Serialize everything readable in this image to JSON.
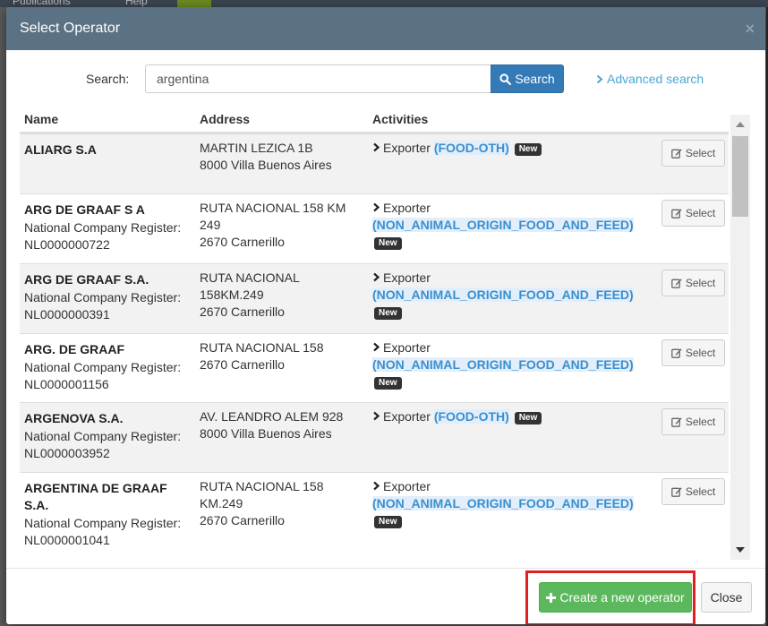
{
  "background": {
    "menu_publications": "Publications",
    "menu_help": "Help"
  },
  "modal": {
    "title": "Select Operator",
    "close_glyph": "×"
  },
  "search": {
    "label": "Search:",
    "value": "argentina",
    "button_label": "Search",
    "advanced_label": "Advanced search"
  },
  "table": {
    "headers": {
      "name": "Name",
      "address": "Address",
      "activities": "Activities"
    },
    "select_label": "Select",
    "rows": [
      {
        "name": "ALIARG S.A",
        "reg_label": "",
        "reg_no": "",
        "addr1": "MARTIN LEZICA 1B",
        "addr2": "8000 Villa Buenos Aires",
        "activity": "Exporter",
        "code": "(FOOD-OTH)",
        "badge": "New"
      },
      {
        "name": "ARG DE GRAAF S A",
        "reg_label": "National Company Register:",
        "reg_no": "NL0000000722",
        "addr1": "RUTA NACIONAL 158 KM 249",
        "addr2": "2670 Carnerillo",
        "activity": "Exporter",
        "code": "(NON_ANIMAL_ORIGIN_FOOD_AND_FEED)",
        "badge": "New"
      },
      {
        "name": "ARG DE GRAAF S.A.",
        "reg_label": "National Company Register:",
        "reg_no": "NL0000000391",
        "addr1": "RUTA NACIONAL 158KM.249",
        "addr2": "2670 Carnerillo",
        "activity": "Exporter",
        "code": "(NON_ANIMAL_ORIGIN_FOOD_AND_FEED)",
        "badge": "New"
      },
      {
        "name": "ARG. DE GRAAF",
        "reg_label": "National Company Register:",
        "reg_no": "NL0000001156",
        "addr1": "RUTA NACIONAL 158",
        "addr2": "2670 Carnerillo",
        "activity": "Exporter",
        "code": "(NON_ANIMAL_ORIGIN_FOOD_AND_FEED)",
        "badge": "New"
      },
      {
        "name": "ARGENOVA S.A.",
        "reg_label": "National Company Register:",
        "reg_no": "NL0000003952",
        "addr1": "AV. LEANDRO ALEM 928",
        "addr2": "8000 Villa Buenos Aires",
        "activity": "Exporter",
        "code": "(FOOD-OTH)",
        "badge": "New"
      },
      {
        "name": "ARGENTINA DE GRAAF S.A.",
        "reg_label": "National Company Register:",
        "reg_no": "NL0000001041",
        "addr1": "RUTA NACIONAL 158 KM.249",
        "addr2": "2670 Carnerillo",
        "activity": "Exporter",
        "code": "(NON_ANIMAL_ORIGIN_FOOD_AND_FEED)",
        "badge": "New"
      }
    ]
  },
  "footer": {
    "create_label": "Create a new operator",
    "close_label": "Close"
  },
  "colors": {
    "header": "#5b7284",
    "primary": "#337ab7",
    "success": "#5cb85c",
    "highlight": "#e02020",
    "link": "#4aa6d8"
  }
}
